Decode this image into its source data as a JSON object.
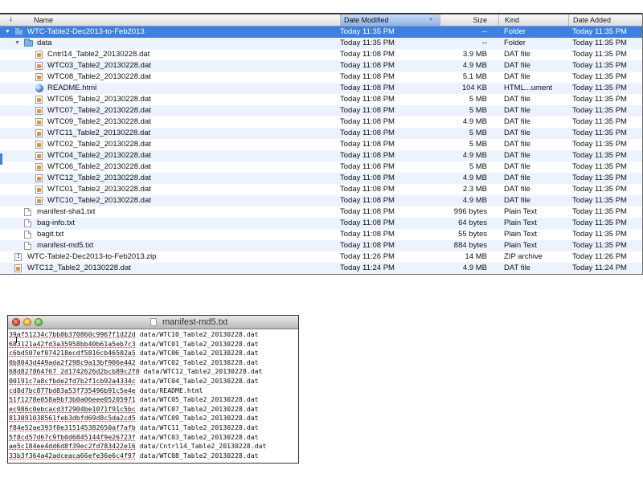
{
  "finder": {
    "columns": {
      "name": "Name",
      "date_modified": "Date Modified",
      "size": "Size",
      "kind": "Kind",
      "date_added": "Date Added"
    },
    "rows": [
      {
        "name": "WTC-Table2-Dec2013-to-Feb2013",
        "date": "Today 11:35 PM",
        "size": "--",
        "kind": "Folder",
        "added": "Today 11:35 PM",
        "icon": "folder-icon",
        "level": 0,
        "disclosure": "expanded",
        "selected": true
      },
      {
        "name": "data",
        "date": "Today 11:35 PM",
        "size": "--",
        "kind": "Folder",
        "added": "Today 11:35 PM",
        "icon": "folder-icon",
        "level": 1,
        "disclosure": "expanded",
        "selected": false
      },
      {
        "name": "Cntrl14_Table2_20130228.dat",
        "date": "Today 11:08 PM",
        "size": "3.9 MB",
        "kind": "DAT file",
        "added": "Today 11:35 PM",
        "icon": "dat-file-icon",
        "level": 2
      },
      {
        "name": "WTC03_Table2_20130228.dat",
        "date": "Today 11:08 PM",
        "size": "4.9 MB",
        "kind": "DAT file",
        "added": "Today 11:35 PM",
        "icon": "dat-file-icon",
        "level": 2
      },
      {
        "name": "WTC08_Table2_20130228.dat",
        "date": "Today 11:08 PM",
        "size": "5.1 MB",
        "kind": "DAT file",
        "added": "Today 11:35 PM",
        "icon": "dat-file-icon",
        "level": 2
      },
      {
        "name": "README.html",
        "date": "Today 11:08 PM",
        "size": "104 KB",
        "kind": "HTML...ument",
        "added": "Today 11:35 PM",
        "icon": "html-file-icon",
        "level": 2
      },
      {
        "name": "WTC05_Table2_20130228.dat",
        "date": "Today 11:08 PM",
        "size": "5 MB",
        "kind": "DAT file",
        "added": "Today 11:35 PM",
        "icon": "dat-file-icon",
        "level": 2
      },
      {
        "name": "WTC07_Table2_20130228.dat",
        "date": "Today 11:08 PM",
        "size": "5 MB",
        "kind": "DAT file",
        "added": "Today 11:35 PM",
        "icon": "dat-file-icon",
        "level": 2
      },
      {
        "name": "WTC09_Table2_20130228.dat",
        "date": "Today 11:08 PM",
        "size": "4.9 MB",
        "kind": "DAT file",
        "added": "Today 11:35 PM",
        "icon": "dat-file-icon",
        "level": 2
      },
      {
        "name": "WTC11_Table2_20130228.dat",
        "date": "Today 11:08 PM",
        "size": "5 MB",
        "kind": "DAT file",
        "added": "Today 11:35 PM",
        "icon": "dat-file-icon",
        "level": 2
      },
      {
        "name": "WTC02_Table2_20130228.dat",
        "date": "Today 11:08 PM",
        "size": "5 MB",
        "kind": "DAT file",
        "added": "Today 11:35 PM",
        "icon": "dat-file-icon",
        "level": 2
      },
      {
        "name": "WTC04_Table2_20130228.dat",
        "date": "Today 11:08 PM",
        "size": "4.9 MB",
        "kind": "DAT file",
        "added": "Today 11:35 PM",
        "icon": "dat-file-icon",
        "level": 2
      },
      {
        "name": "WTC06_Table2_20130228.dat",
        "date": "Today 11:08 PM",
        "size": "5 MB",
        "kind": "DAT file",
        "added": "Today 11:35 PM",
        "icon": "dat-file-icon",
        "level": 2
      },
      {
        "name": "WTC12_Table2_20130228.dat",
        "date": "Today 11:08 PM",
        "size": "4.9 MB",
        "kind": "DAT file",
        "added": "Today 11:35 PM",
        "icon": "dat-file-icon",
        "level": 2
      },
      {
        "name": "WTC01_Table2_20130228.dat",
        "date": "Today 11:08 PM",
        "size": "2.3 MB",
        "kind": "DAT file",
        "added": "Today 11:35 PM",
        "icon": "dat-file-icon",
        "level": 2
      },
      {
        "name": "WTC10_Table2_20130228.dat",
        "date": "Today 11:08 PM",
        "size": "4.9 MB",
        "kind": "DAT file",
        "added": "Today 11:35 PM",
        "icon": "dat-file-icon",
        "level": 2
      },
      {
        "name": "manifest-sha1.txt",
        "date": "Today 11:08 PM",
        "size": "996 bytes",
        "kind": "Plain Text",
        "added": "Today 11:35 PM",
        "icon": "text-file-icon",
        "level": 1
      },
      {
        "name": "bag-info.txt",
        "date": "Today 11:08 PM",
        "size": "64 bytes",
        "kind": "Plain Text",
        "added": "Today 11:35 PM",
        "icon": "text-file-icon",
        "level": 1
      },
      {
        "name": "bagit.txt",
        "date": "Today 11:08 PM",
        "size": "55 bytes",
        "kind": "Plain Text",
        "added": "Today 11:35 PM",
        "icon": "text-file-icon",
        "level": 1
      },
      {
        "name": "manifest-md5.txt",
        "date": "Today 11:08 PM",
        "size": "884 bytes",
        "kind": "Plain Text",
        "added": "Today 11:35 PM",
        "icon": "text-file-icon",
        "level": 1
      },
      {
        "name": "WTC-Table2-Dec2013-to-Feb2013.zip",
        "date": "Today 11:26 PM",
        "size": "14 MB",
        "kind": "ZIP archive",
        "added": "Today 11:26 PM",
        "icon": "zip-file-icon",
        "level": 0
      },
      {
        "name": "WTC12_Table2_20130228.dat",
        "date": "Today 11:24 PM",
        "size": "4.9 MB",
        "kind": "DAT file",
        "added": "Today 11:24 PM",
        "icon": "dat-file-icon",
        "level": 0
      }
    ]
  },
  "text_window": {
    "title": "manifest-md5.txt",
    "lines": [
      {
        "hash": "39af51234c7bb0b370860c9967f1d22d",
        "path": "data/WTC10_Table2_20130228.dat"
      },
      {
        "hash": "683121a42fd3a35958bb40b61a5eb7c3",
        "path": "data/WTC01_Table2_20130228.dat"
      },
      {
        "hash": "c6bd507ef074218ecdf5816cb46502a5",
        "path": "data/WTC06_Table2_20130228.dat"
      },
      {
        "hash": "0b8043d449ada2f298c9a13bf906e442",
        "path": "data/WTC02_Table2_20130228.dat"
      },
      {
        "hash": "68d827864767 2d1742626d2bcb89c2f0",
        "path": "data/WTC12_Table2_20130228.dat"
      },
      {
        "hash": "00191c7a8cfbde2fd7b2f1cb92a4334c",
        "path": "data/WTC04_Table2_20130228.dat"
      },
      {
        "hash": "cd8d7bc877bd83a53f735496b91c5e4e",
        "path": "data/README.html"
      },
      {
        "hash": "51f1278e058a9bf3b0a06eee05205971",
        "path": "data/WTC05_Table2_20130228.dat"
      },
      {
        "hash": "ec986c0ebcacd3f2904be1071f91c5bc",
        "path": "data/WTC07_Table2_20130228.dat"
      },
      {
        "hash": "813091038561feb3dbfd69d8c5da2cd5",
        "path": "data/WTC09_Table2_20130228.dat"
      },
      {
        "hash": "f84e52ae393f0e315145382650af7afb",
        "path": "data/WTC11_Table2_20130228.dat"
      },
      {
        "hash": "5f8cd57d67c9fb0d6845144f9e26723f",
        "path": "data/WTC03_Table2_20130228.dat"
      },
      {
        "hash": "ae5c184ee4dd6d8f39ec2fd783422e16",
        "path": "data/Cntrl14_Table2_20130228.dat"
      },
      {
        "hash": "33b3f364a42adceaca66efe36e6c4f97",
        "path": "data/WTC08_Table2_20130228.dat"
      }
    ]
  }
}
